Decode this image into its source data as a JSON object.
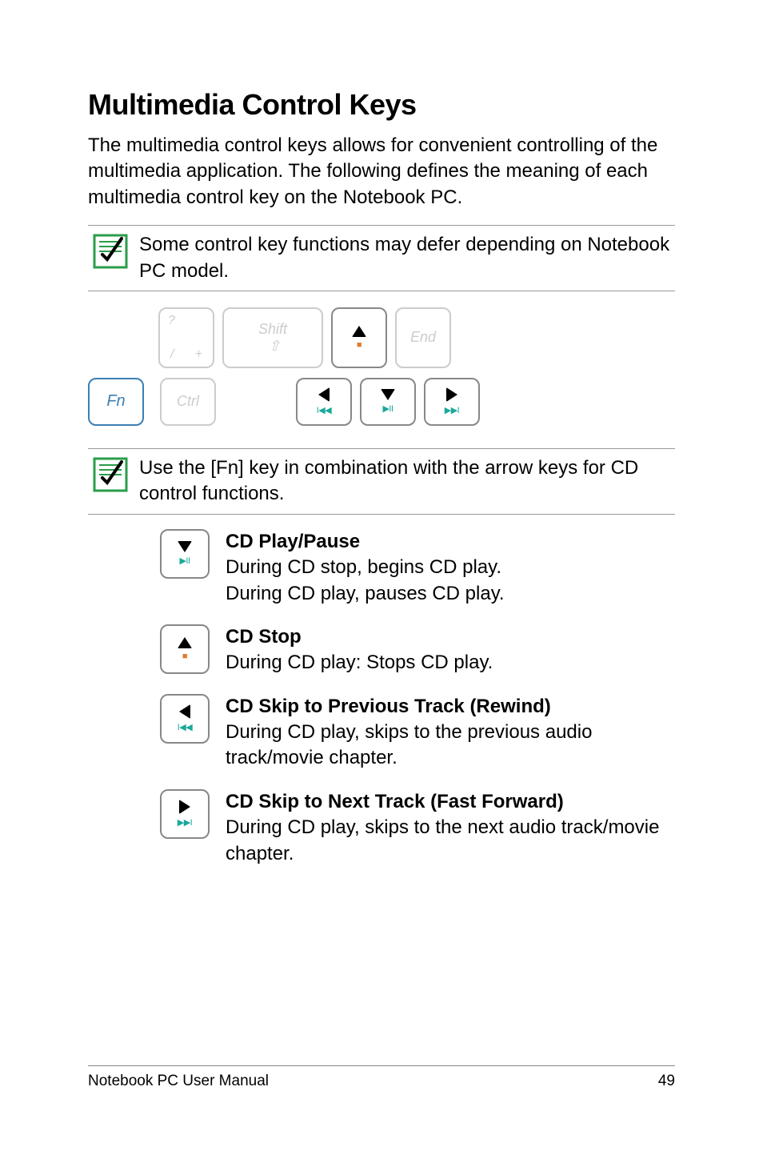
{
  "heading": "Multimedia Control Keys",
  "intro": "The multimedia control keys allows for convenient controlling of the multimedia application. The following defines the meaning of each multimedia control key on the Notebook PC.",
  "note1": "Some control key functions may defer depending on Notebook PC model.",
  "note2": "Use the [Fn] key in combination with the arrow keys for CD control functions.",
  "keys": {
    "slash_top": "?",
    "slash_bot_left": "/",
    "slash_bot_right": "+",
    "shift": "Shift",
    "end": "End",
    "fn": "Fn",
    "ctrl": "Ctrl",
    "up_sub": "■",
    "down_sub": "▶II",
    "left_sub": "I◀◀",
    "right_sub": "▶▶I"
  },
  "sections": [
    {
      "title": "CD Play/Pause",
      "line1": "During CD stop, begins CD play.",
      "line2": "During CD play, pauses CD play."
    },
    {
      "title": "CD Stop",
      "line1": "During CD play: Stops CD play.",
      "line2": ""
    },
    {
      "title": "CD Skip to Previous Track (Rewind)",
      "line1": "During CD play, skips to the previous audio track/movie chapter.",
      "line2": ""
    },
    {
      "title": "CD Skip to Next Track (Fast Forward)",
      "line1": "During CD play, skips to the next audio track/movie chapter.",
      "line2": ""
    }
  ],
  "footer_left": "Notebook PC User Manual",
  "footer_right": "49"
}
